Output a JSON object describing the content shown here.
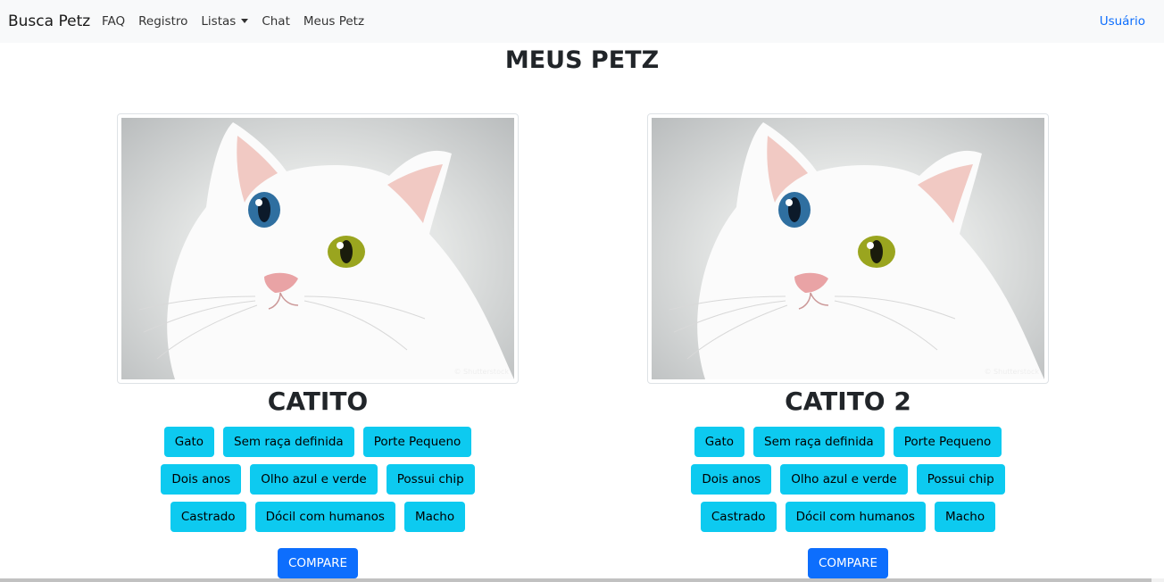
{
  "navbar": {
    "brand": "Busca Petz",
    "links": [
      "FAQ",
      "Registro",
      "Listas",
      "Chat",
      "Meus Petz"
    ],
    "user": "Usuário"
  },
  "page": {
    "title": "MEUS PETZ"
  },
  "pets": [
    {
      "name": "CATITO",
      "watermark": "© Shutterstock",
      "tags": [
        "Gato",
        "Sem raça definida",
        "Porte Pequeno",
        "Dois anos",
        "Olho azul e verde",
        "Possui chip",
        "Castrado",
        "Dócil com humanos",
        "Macho"
      ],
      "compare_label": "COMPARE"
    },
    {
      "name": "CATITO 2",
      "watermark": "© Shutterstock",
      "tags": [
        "Gato",
        "Sem raça definida",
        "Porte Pequeno",
        "Dois anos",
        "Olho azul e verde",
        "Possui chip",
        "Castrado",
        "Dócil com humanos",
        "Macho"
      ],
      "compare_label": "COMPARE"
    }
  ],
  "colors": {
    "info": "#0dcaf0",
    "primary": "#0d6efd",
    "navbar_bg": "#f8f9fa"
  }
}
